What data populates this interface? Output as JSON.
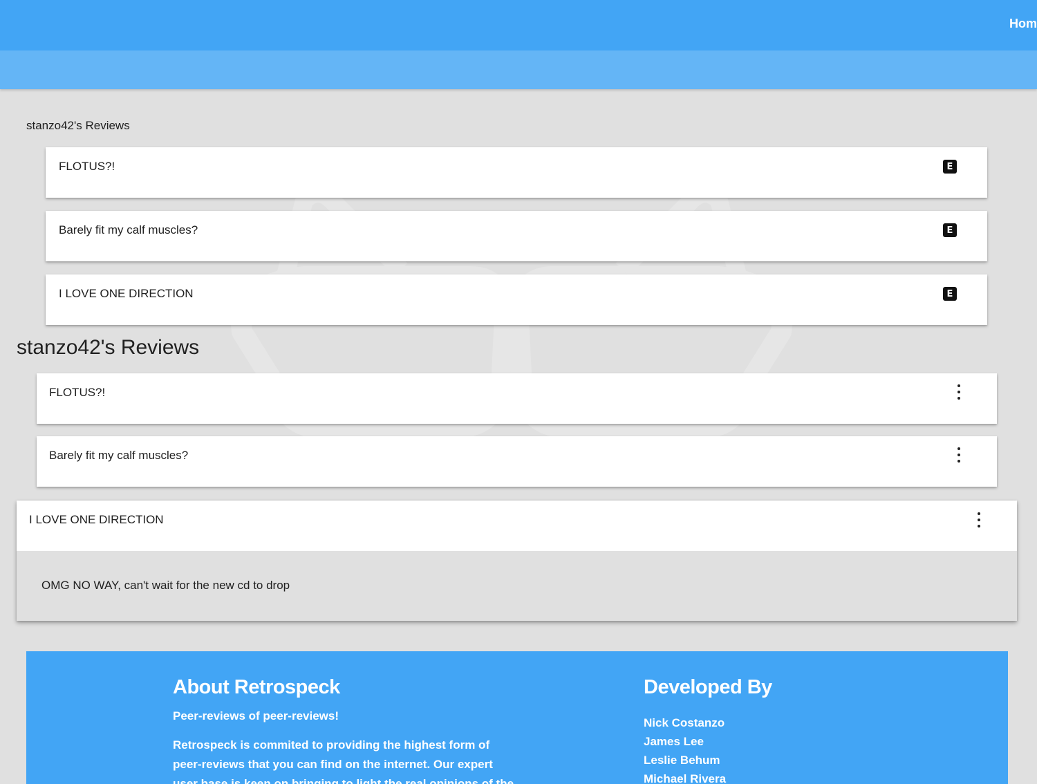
{
  "nav": {
    "home_label": "Home"
  },
  "section_small": {
    "heading": "stanzo42's Reviews",
    "reviews": [
      {
        "title": "FLOTUS?!",
        "icon": "e-icon"
      },
      {
        "title": "Barely fit my calf muscles?",
        "icon": "e-icon"
      },
      {
        "title": "I LOVE ONE DIRECTION",
        "icon": "e-icon"
      }
    ]
  },
  "section_large": {
    "heading": "stanzo42's Reviews",
    "reviews": [
      {
        "title": "FLOTUS?!",
        "icon": "more-vert-icon"
      },
      {
        "title": "Barely fit my calf muscles?",
        "icon": "more-vert-icon"
      },
      {
        "title": "I LOVE ONE DIRECTION",
        "icon": "more-vert-icon",
        "expanded": true,
        "body": "OMG NO WAY, can't wait for the new cd to drop"
      }
    ]
  },
  "footer": {
    "about_title": "About Retrospeck",
    "about_tagline": "Peer-reviews of peer-reviews!",
    "about_text": "Retrospeck is commited to providing the highest form of peer-reviews that you can find on the internet. Our expert user base is keen on bringing to light the real opinions of the",
    "dev_title": "Developed By",
    "developers": [
      "Nick Costanzo",
      "James Lee",
      "Leslie Behum",
      "Michael Rivera"
    ]
  },
  "colors": {
    "primary": "#42a5f5",
    "primary_light": "#64b5f6",
    "background": "#e0e0e0"
  }
}
